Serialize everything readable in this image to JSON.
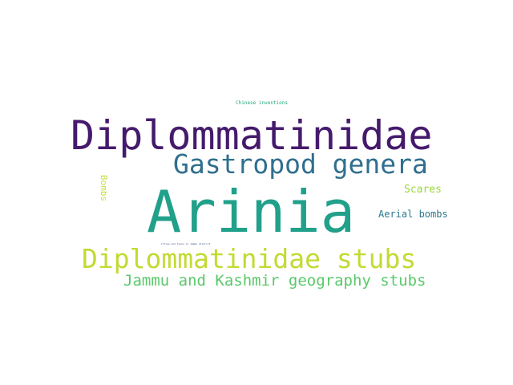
{
  "words": [
    {
      "text": "Chinese inventions",
      "color": "#26a47e"
    },
    {
      "text": "Diplommatinidae",
      "color": "#451a6c"
    },
    {
      "text": "Gastropod genera",
      "color": "#2f6f8e"
    },
    {
      "text": "Bombs",
      "color": "#c8dd3b"
    },
    {
      "text": "Scares",
      "color": "#9bd83a"
    },
    {
      "text": "Arinia",
      "color": "#21a08a"
    },
    {
      "text": "Aerial bombs",
      "color": "#29788e"
    },
    {
      "text": "Cities and towns in Jammu district",
      "color": "#3e4a89"
    },
    {
      "text": "Diplommatinidae stubs",
      "color": "#c3da32"
    },
    {
      "text": "Jammu and Kashmir geography stubs",
      "color": "#5ac86a"
    }
  ]
}
